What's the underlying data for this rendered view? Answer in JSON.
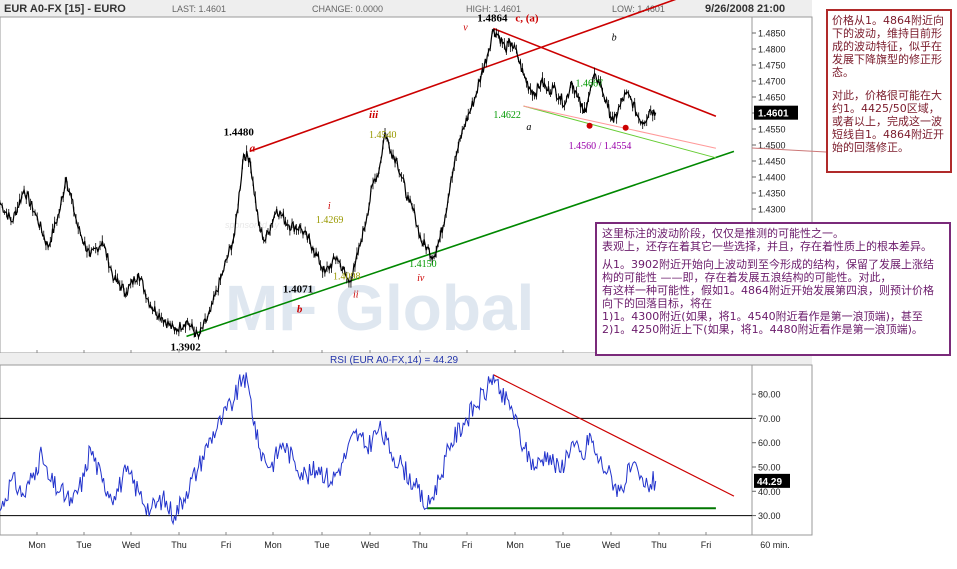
{
  "header": {
    "symbol": "EUR A0-FX [15] - EURO",
    "last": "LAST: 1.4601",
    "change": "CHANGE: 0.0000",
    "high": "HIGH: 1.4601",
    "low": "LOW: 1.4601",
    "datetime": "9/26/2008 21:00"
  },
  "chart_data": [
    {
      "type": "line",
      "title": "EUR A0-FX [15] - EURO",
      "xlabel": "",
      "ylabel": "",
      "ylim": [
        1.385,
        1.49
      ],
      "y_ticks": [
        1.485,
        1.48,
        1.475,
        1.47,
        1.465,
        1.46,
        1.455,
        1.45,
        1.445,
        1.44,
        1.435,
        1.43
      ],
      "y_tick_labels": [
        "1.4850",
        "1.4800",
        "1.4750",
        "1.4700",
        "1.4650",
        "",
        "1.4550",
        "1.4500",
        "1.4450",
        "1.4400",
        "1.4350",
        "1.4300"
      ],
      "x_tick_labels": [
        "Mon",
        "Tue",
        "Wed",
        "Thu",
        "Fri",
        "Mon",
        "Tue",
        "Wed",
        "Thu",
        "Fri",
        "Mon",
        "Tue",
        "Wed",
        "Thu",
        "Fri",
        "60 min."
      ],
      "last_value_tag": "1.4601",
      "price_path": [
        [
          0,
          1.432
        ],
        [
          2,
          1.426
        ],
        [
          4,
          1.436
        ],
        [
          6,
          1.428
        ],
        [
          8,
          1.418
        ],
        [
          10,
          1.43
        ],
        [
          11,
          1.44
        ],
        [
          13,
          1.424
        ],
        [
          15,
          1.415
        ],
        [
          17,
          1.42
        ],
        [
          19,
          1.408
        ],
        [
          21,
          1.404
        ],
        [
          23,
          1.41
        ],
        [
          25,
          1.4
        ],
        [
          27,
          1.396
        ],
        [
          29,
          1.392
        ],
        [
          31,
          1.395
        ],
        [
          33,
          1.39
        ],
        [
          35,
          1.398
        ],
        [
          37,
          1.41
        ],
        [
          39,
          1.422
        ],
        [
          40.5,
          1.447
        ],
        [
          41.5,
          1.446
        ],
        [
          43,
          1.425
        ],
        [
          44,
          1.42
        ],
        [
          46,
          1.43
        ],
        [
          48,
          1.425
        ],
        [
          50,
          1.424
        ],
        [
          52,
          1.418
        ],
        [
          54,
          1.41
        ],
        [
          56,
          1.415
        ],
        [
          58,
          1.407
        ],
        [
          59,
          1.412
        ],
        [
          60,
          1.42
        ],
        [
          61,
          1.428
        ],
        [
          62,
          1.438
        ],
        [
          63,
          1.442
        ],
        [
          64,
          1.454
        ],
        [
          65,
          1.448
        ],
        [
          66,
          1.445
        ],
        [
          68,
          1.432
        ],
        [
          69,
          1.428
        ],
        [
          70,
          1.42
        ],
        [
          71,
          1.418
        ],
        [
          72,
          1.415
        ],
        [
          73,
          1.42
        ],
        [
          74,
          1.428
        ],
        [
          75,
          1.44
        ],
        [
          76,
          1.448
        ],
        [
          77,
          1.455
        ],
        [
          78,
          1.46
        ],
        [
          79,
          1.465
        ],
        [
          80,
          1.472
        ],
        [
          81,
          1.478
        ],
        [
          82,
          1.486
        ],
        [
          83,
          1.484
        ],
        [
          84,
          1.48
        ],
        [
          85,
          1.482
        ],
        [
          86,
          1.478
        ],
        [
          87,
          1.472
        ],
        [
          88,
          1.468
        ],
        [
          89,
          1.466
        ],
        [
          90,
          1.47
        ],
        [
          91,
          1.467
        ],
        [
          92,
          1.468
        ],
        [
          93,
          1.465
        ],
        [
          94,
          1.463
        ],
        [
          95,
          1.47
        ],
        [
          96,
          1.465
        ],
        [
          97,
          1.46
        ],
        [
          98,
          1.466
        ],
        [
          99,
          1.472
        ],
        [
          100,
          1.468
        ],
        [
          101,
          1.462
        ],
        [
          102,
          1.457
        ],
        [
          103,
          1.462
        ],
        [
          104,
          1.466
        ],
        [
          105,
          1.464
        ],
        [
          106,
          1.459
        ],
        [
          107,
          1.457
        ],
        [
          108,
          1.461
        ],
        [
          109,
          1.4601
        ]
      ],
      "wave_labels": [
        {
          "text": "1.4864",
          "x": 82,
          "y": 1.4864,
          "color": "#000000",
          "bold": true
        },
        {
          "text": "c, (a)",
          "x": 84,
          "y": 1.4864,
          "color": "#cc0000",
          "bold": true
        },
        {
          "text": "v",
          "x": 79,
          "y": 1.4864,
          "color": "#cc0000",
          "bold": false
        },
        {
          "text": "b",
          "x": 100,
          "y": 1.4864,
          "color": "#000000",
          "bold": false
        },
        {
          "text": "1.4667",
          "x": 97,
          "y": 1.4667,
          "color": "#009900",
          "bold": false
        },
        {
          "text": "1.4622",
          "x": 86,
          "y": 1.4622,
          "color": "#009900",
          "bold": false
        },
        {
          "text": "a",
          "x": 87.5,
          "y": 1.4622,
          "color": "#000000",
          "bold": false
        },
        {
          "text": "1.4560 / 1.4554",
          "x": 99.5,
          "y": 1.4557,
          "color": "#9900aa",
          "bold": false
        },
        {
          "text": "a",
          "x": 41.5,
          "y": 1.448,
          "color": "#cc0000",
          "bold": true
        },
        {
          "text": "1.4480",
          "x": 41.5,
          "y": 1.448,
          "color": "#000000",
          "bold": true
        },
        {
          "text": "iii",
          "x": 65,
          "y": 1.454,
          "color": "#cc0000",
          "bold": true
        },
        {
          "text": "1.4540",
          "x": 65,
          "y": 1.454,
          "color": "#999900",
          "bold": false
        },
        {
          "text": "i",
          "x": 56.5,
          "y": 1.4269,
          "color": "#cc0000",
          "bold": false
        },
        {
          "text": "1.4269",
          "x": 56.5,
          "y": 1.4269,
          "color": "#999900",
          "bold": false
        },
        {
          "text": "ii",
          "x": 59,
          "y": 1.4098,
          "color": "#cc0000",
          "bold": false
        },
        {
          "text": "1.4098",
          "x": 59,
          "y": 1.4098,
          "color": "#999900",
          "bold": false
        },
        {
          "text": "1.4071",
          "x": 53,
          "y": 1.4071,
          "color": "#000000",
          "bold": true
        },
        {
          "text": "b",
          "x": 53,
          "y": 1.4071,
          "color": "#cc0000",
          "bold": true
        },
        {
          "text": "1.4150",
          "x": 71,
          "y": 1.415,
          "color": "#009900",
          "bold": false
        },
        {
          "text": "iv",
          "x": 71,
          "y": 1.415,
          "color": "#cc0000",
          "bold": false
        },
        {
          "text": "1.3902",
          "x": 31,
          "y": 1.3902,
          "color": "#000000",
          "bold": true
        }
      ],
      "trendlines": [
        {
          "name": "upper-channel",
          "color": "#cc0000",
          "from": [
            41.5,
            1.448
          ],
          "to": [
            116,
            1.498
          ]
        },
        {
          "name": "falling-resistance",
          "color": "#cc0000",
          "from": [
            82,
            1.4864
          ],
          "to": [
            119,
            1.459
          ]
        },
        {
          "name": "lower-channel",
          "color": "#008800",
          "from": [
            31,
            1.3902
          ],
          "to": [
            122,
            1.448
          ]
        },
        {
          "name": "flag-support",
          "color": "#66cc33",
          "from": [
            87,
            1.4622
          ],
          "to": [
            119,
            1.446
          ]
        },
        {
          "name": "flag-mid",
          "color": "#ff9999",
          "from": [
            87,
            1.4622
          ],
          "to": [
            119,
            1.449
          ]
        }
      ],
      "markers": [
        {
          "x": 98,
          "y": 1.456,
          "color": "#cc0000"
        },
        {
          "x": 104,
          "y": 1.4554,
          "color": "#cc0000"
        }
      ]
    },
    {
      "type": "line",
      "title": "RSI (EUR A0-FX,14) = 44.29",
      "xlabel": "",
      "ylabel": "",
      "ylim": [
        22,
        92
      ],
      "y_ticks": [
        80,
        70,
        60,
        50,
        40,
        30
      ],
      "y_tick_labels": [
        "80.00",
        "70.00",
        "60.00",
        "50.00",
        "40.00",
        "30.00"
      ],
      "last_value_tag": "44.29",
      "reference_lines": [
        70,
        30
      ],
      "rsi_path": [
        [
          0,
          32
        ],
        [
          2,
          45
        ],
        [
          4,
          38
        ],
        [
          6,
          50
        ],
        [
          7,
          55
        ],
        [
          8,
          45
        ],
        [
          10,
          40
        ],
        [
          12,
          35
        ],
        [
          14,
          46
        ],
        [
          15,
          58
        ],
        [
          17,
          44
        ],
        [
          19,
          38
        ],
        [
          21,
          48
        ],
        [
          23,
          40
        ],
        [
          25,
          32
        ],
        [
          27,
          37
        ],
        [
          29,
          30
        ],
        [
          31,
          40
        ],
        [
          33,
          50
        ],
        [
          35,
          62
        ],
        [
          37,
          70
        ],
        [
          39,
          78
        ],
        [
          40.5,
          88
        ],
        [
          41.5,
          80
        ],
        [
          43,
          58
        ],
        [
          45,
          50
        ],
        [
          47,
          60
        ],
        [
          49,
          52
        ],
        [
          51,
          46
        ],
        [
          53,
          50
        ],
        [
          55,
          44
        ],
        [
          57,
          52
        ],
        [
          59,
          64
        ],
        [
          61,
          58
        ],
        [
          63,
          66
        ],
        [
          65,
          56
        ],
        [
          67,
          50
        ],
        [
          69,
          42
        ],
        [
          71,
          33
        ],
        [
          73,
          45
        ],
        [
          75,
          60
        ],
        [
          77,
          68
        ],
        [
          79,
          75
        ],
        [
          81,
          82
        ],
        [
          82,
          88
        ],
        [
          83,
          80
        ],
        [
          85,
          75
        ],
        [
          87,
          58
        ],
        [
          89,
          50
        ],
        [
          91,
          56
        ],
        [
          93,
          48
        ],
        [
          95,
          60
        ],
        [
          97,
          53
        ],
        [
          98,
          64
        ],
        [
          99,
          55
        ],
        [
          101,
          48
        ],
        [
          103,
          40
        ],
        [
          105,
          50
        ],
        [
          107,
          42
        ],
        [
          109,
          44.29
        ]
      ],
      "trendlines": [
        {
          "name": "rsi-falling",
          "color": "#cc0000",
          "from": [
            82,
            88
          ],
          "to": [
            122,
            38
          ]
        },
        {
          "name": "rsi-support",
          "color": "#007700",
          "from": [
            71,
            33
          ],
          "to": [
            119,
            33
          ]
        }
      ]
    }
  ],
  "notes": {
    "right": [
      "价格从1。4864附近向下的波动，维持目前形成的波动特征，似乎在发展下降旗型的修正形态。",
      "对此，价格很可能在大约1。4425/50区域，或者以上，完成这一波短线自1。4864附近开始的回落修正。"
    ],
    "middle": [
      "这里标注的波动阶段，仅仅是推测的可能性之一。",
      "表观上，还存在着其它一些选择，并且，存在着性质上的根本差异。",
      "从1。3902附近开始向上波动到至今形成的结构，保留了发展上涨结构的可能性 ——即，存在着发展五浪结构的可能性。对此，",
      "有这样一种可能性，假如1。4864附近开始发展第四浪，则预计价格向下的回落目标，将在",
      "1)1。4300附近(如果，将1。4540附近看作是第一浪顶端)，甚至",
      "2)1。4250附近上下(如果，将1。4480附近看作是第一浪顶端)。"
    ]
  },
  "watermark": {
    "text": "MF Global",
    "sub": "sponsored by"
  }
}
